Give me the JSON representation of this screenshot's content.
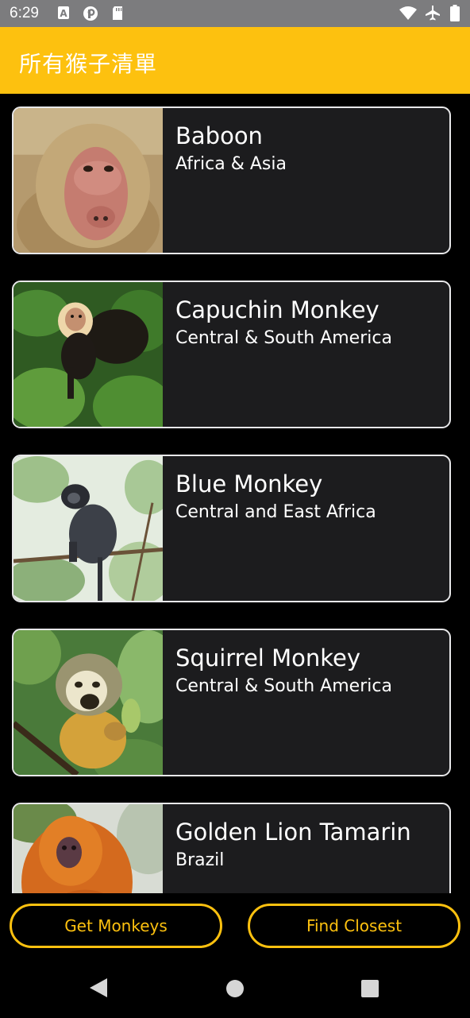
{
  "status_bar": {
    "time": "6:29",
    "icons_left": [
      "text-a-icon",
      "p-circle-icon",
      "sd-card-icon"
    ],
    "icons_right": [
      "wifi-icon",
      "airplane-icon",
      "battery-icon"
    ]
  },
  "app_bar": {
    "title": "所有猴子清單"
  },
  "monkeys": [
    {
      "name": "Baboon",
      "location": "Africa & Asia"
    },
    {
      "name": "Capuchin Monkey",
      "location": "Central & South America"
    },
    {
      "name": "Blue Monkey",
      "location": "Central and East Africa"
    },
    {
      "name": "Squirrel Monkey",
      "location": "Central & South America"
    },
    {
      "name": "Golden Lion Tamarin",
      "location": "Brazil"
    }
  ],
  "buttons": {
    "get_monkeys": "Get Monkeys",
    "find_closest": "Find Closest"
  },
  "colors": {
    "accent": "#fdc10f",
    "card_bg": "#1c1c1e",
    "card_border": "#e8e8ea",
    "status_bar": "#7c7c7e"
  }
}
